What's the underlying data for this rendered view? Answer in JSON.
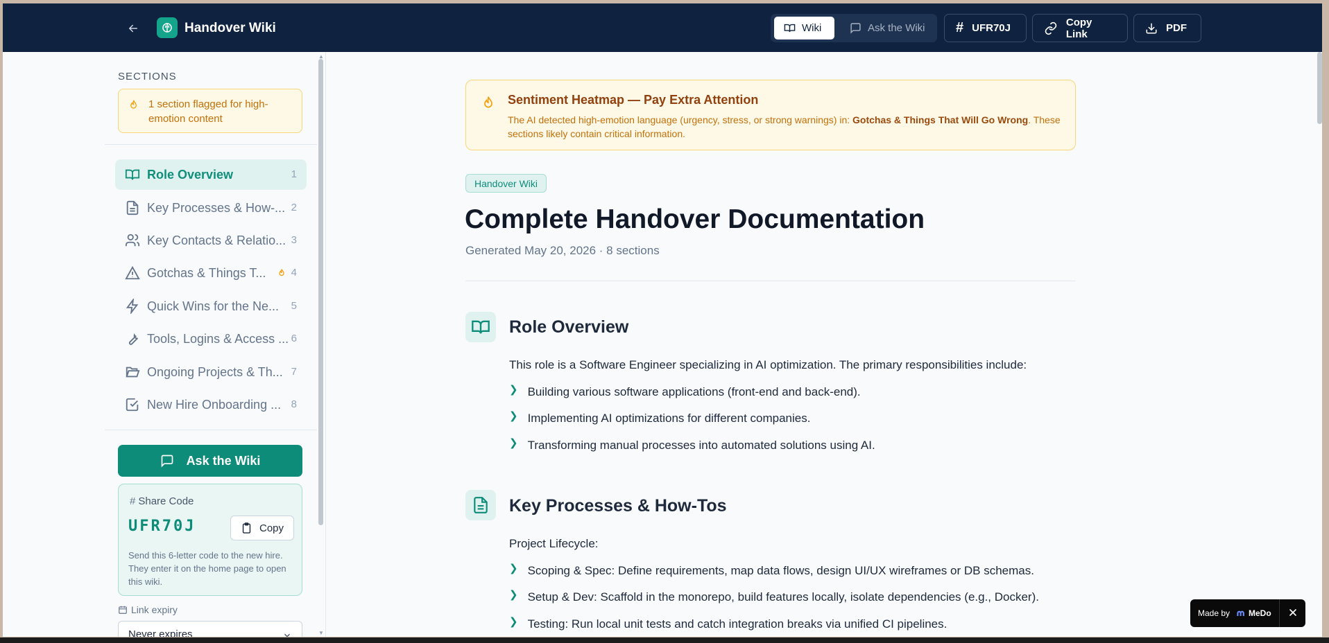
{
  "app": {
    "title": "Handover Wiki"
  },
  "topbar": {
    "tabs": [
      {
        "label": "Wiki",
        "active": true
      },
      {
        "label": "Ask the Wiki",
        "active": false
      }
    ],
    "code_button": "UFR70J",
    "copy_link": "Copy Link",
    "pdf": "PDF"
  },
  "sidebar": {
    "title": "SECTIONS",
    "flag_notice": "1 section flagged for high-emotion content",
    "items": [
      {
        "label": "Role Overview",
        "num": "1",
        "icon": "book-open-icon",
        "active": true
      },
      {
        "label": "Key Processes & How-...",
        "num": "2",
        "icon": "file-text-icon"
      },
      {
        "label": "Key Contacts & Relatio...",
        "num": "3",
        "icon": "users-icon"
      },
      {
        "label": "Gotchas & Things T...",
        "num": "4",
        "icon": "warning-triangle-icon",
        "flagged": true
      },
      {
        "label": "Quick Wins for the Ne...",
        "num": "5",
        "icon": "lightning-icon"
      },
      {
        "label": "Tools, Logins & Access ...",
        "num": "6",
        "icon": "wrench-icon"
      },
      {
        "label": "Ongoing Projects & Th...",
        "num": "7",
        "icon": "folder-open-icon"
      },
      {
        "label": "New Hire Onboarding ...",
        "num": "8",
        "icon": "checkbox-icon"
      }
    ],
    "ask_button": "Ask the Wiki",
    "share": {
      "title": "Share Code",
      "code": "UFR70J",
      "copy_label": "Copy",
      "description": "Send this 6-letter code to the new hire. They enter it on the home page to open this wiki."
    },
    "expiry": {
      "label": "Link expiry",
      "value": "Never expires"
    }
  },
  "main": {
    "alert": {
      "title": "Sentiment Heatmap — Pay Extra Attention",
      "text_before": "The AI detected high-emotion language (urgency, stress, or strong warnings) in: ",
      "text_bold": "Gotchas & Things That Will Go Wrong",
      "text_after": ". These sections likely contain critical information."
    },
    "badge": "Handover Wiki",
    "title": "Complete Handover Documentation",
    "meta": "Generated May 20, 2026 · 8 sections",
    "sections": [
      {
        "title": "Role Overview",
        "intro": "This role is a Software Engineer specializing in AI optimization. The primary responsibilities include:",
        "bullets": [
          "Building various software applications (front-end and back-end).",
          "Implementing AI optimizations for different companies.",
          "Transforming manual processes into automated solutions using AI."
        ]
      },
      {
        "title": "Key Processes & How-Tos",
        "intro": "Project Lifecycle:",
        "bullets": [
          "Scoping & Spec: Define requirements, map data flows, design UI/UX wireframes or DB schemas.",
          "Setup & Dev: Scaffold in the monorepo, build features locally, isolate dependencies (e.g., Docker).",
          "Testing: Run local unit tests and catch integration breaks via unified CI pipelines."
        ]
      }
    ]
  },
  "madeby": {
    "prefix": "Made by",
    "brand": "MeDo"
  },
  "colors": {
    "navy": "#0f2340",
    "teal": "#0e8c7a",
    "amber": "#f59e0b"
  }
}
